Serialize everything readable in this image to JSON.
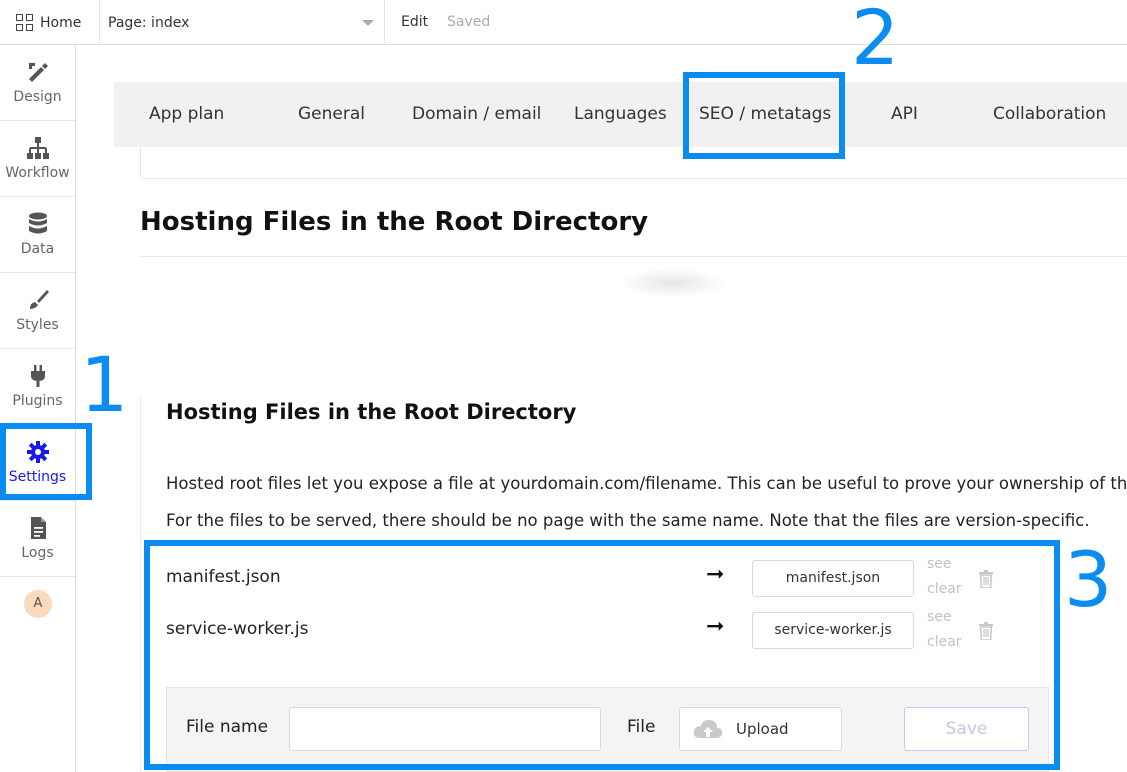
{
  "topbar": {
    "home_label": "Home",
    "page_label": "Page: index",
    "edit_label": "Edit",
    "saved_label": "Saved"
  },
  "sidebar": {
    "items": [
      {
        "label": "Design",
        "icon": "design-icon"
      },
      {
        "label": "Workflow",
        "icon": "workflow-icon"
      },
      {
        "label": "Data",
        "icon": "database-icon"
      },
      {
        "label": "Styles",
        "icon": "brush-icon"
      },
      {
        "label": "Plugins",
        "icon": "plug-icon"
      },
      {
        "label": "Settings",
        "icon": "gear-icon",
        "active": true
      },
      {
        "label": "Logs",
        "icon": "document-icon"
      }
    ],
    "avatar_initial": "A"
  },
  "tabs": [
    "App plan",
    "General",
    "Domain / email",
    "Languages",
    "SEO / metatags",
    "API",
    "Collaboration"
  ],
  "main": {
    "section_title": "Hosting Files in the Root Directory",
    "card_title": "Hosting Files in the Root Directory",
    "description_1": "Hosted root files let you expose a file at yourdomain.com/filename. This can be useful to prove your ownership of the d",
    "description_2": "For the files to be served, there should be no page with the same name. Note that the files are version-specific.",
    "files": [
      {
        "name": "manifest.json",
        "file": "manifest.json",
        "see": "see",
        "clear": "clear"
      },
      {
        "name": "service-worker.js",
        "file": "service-worker.js",
        "see": "see",
        "clear": "clear"
      }
    ],
    "arrow_glyph": "➞",
    "upload_form": {
      "file_name_label": "File name",
      "file_name_value": "",
      "file_label": "File",
      "upload_label": "Upload",
      "save_label": "Save"
    }
  },
  "annotations": {
    "labels": [
      "1",
      "2",
      "3"
    ],
    "color": "#0a8cf0"
  },
  "colors": {
    "active_nav": "#1a1ae6",
    "tab_bar": "#f1f1f1",
    "annotation": "#0a8cf0"
  }
}
